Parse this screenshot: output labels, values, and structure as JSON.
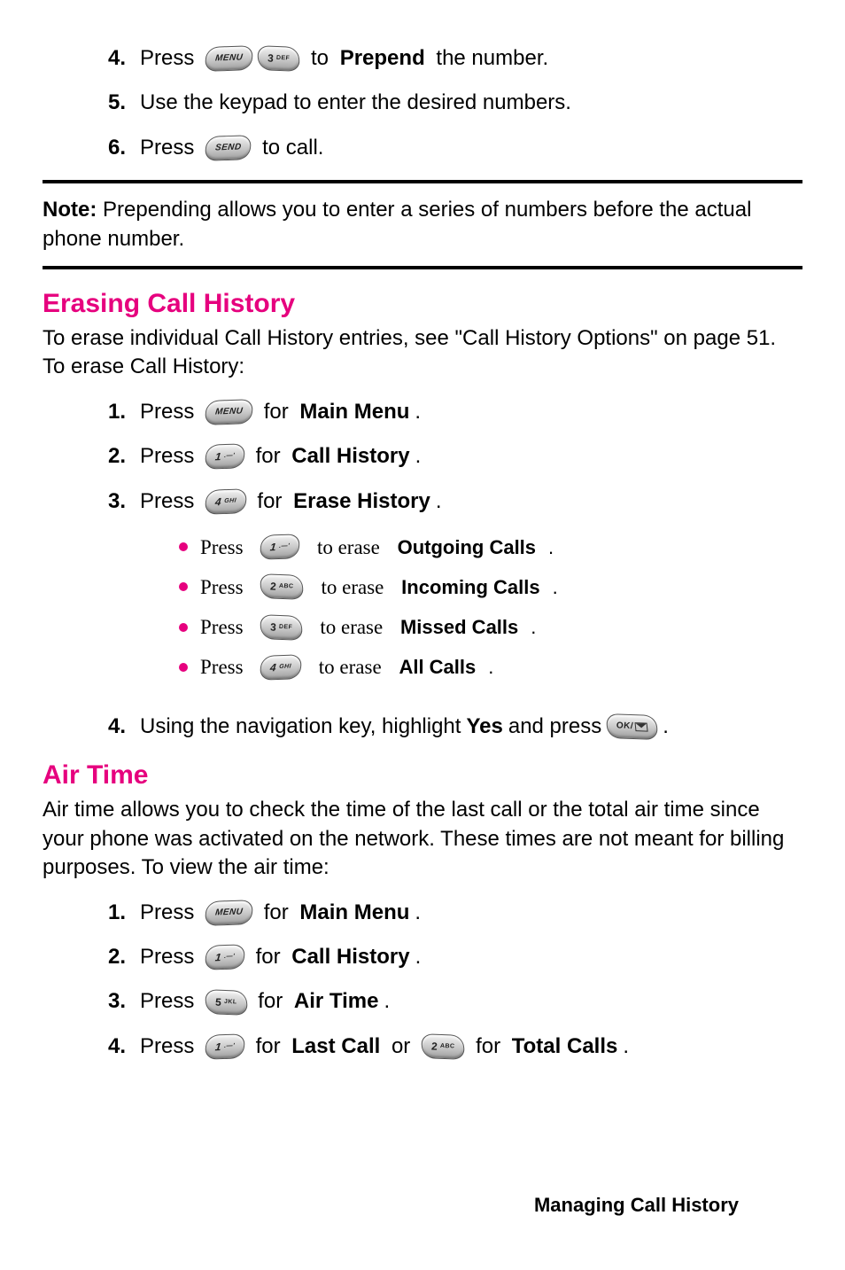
{
  "keys": {
    "menu": "MENU",
    "send": "SEND",
    "ok": "OK",
    "k1": {
      "n": "1",
      "s": ".—'"
    },
    "k2": {
      "n": "2",
      "s": "ABC"
    },
    "k3": {
      "n": "3",
      "s": "DEF"
    },
    "k4": {
      "n": "4",
      "s": "GHI"
    },
    "k5": {
      "n": "5",
      "s": "JKL"
    }
  },
  "top_steps": {
    "s4": {
      "num": "4.",
      "press": "Press ",
      "to": " to ",
      "prepend": "Prepend",
      "tail": " the number."
    },
    "s5": {
      "num": "5.",
      "text": "Use the keypad to enter the desired numbers."
    },
    "s6": {
      "num": "6.",
      "press": "Press ",
      "tail": " to call."
    }
  },
  "note": {
    "label": "Note:",
    "text": " Prepending allows you to enter a series of numbers before the actual phone number."
  },
  "erase": {
    "heading": "Erasing Call History",
    "intro": "To erase individual Call History entries, see \"Call History Options\" on page 51. To erase Call History:",
    "s1": {
      "num": "1.",
      "press": "Press ",
      "for": " for ",
      "target": "Main Menu",
      "dot": "."
    },
    "s2": {
      "num": "2.",
      "press": "Press ",
      "for": " for ",
      "target": "Call History",
      "dot": "."
    },
    "s3": {
      "num": "3.",
      "press": "Press ",
      "for": " for ",
      "target": "Erase History",
      "dot": "."
    },
    "b1": {
      "press": "Press ",
      "to": " to erase ",
      "target": "Outgoing Calls",
      "dot": "."
    },
    "b2": {
      "press": "Press ",
      "to": " to erase ",
      "target": "Incoming Calls",
      "dot": "."
    },
    "b3": {
      "press": "Press ",
      "to": " to erase ",
      "target": "Missed Calls",
      "dot": "."
    },
    "b4": {
      "press": "Press ",
      "to": " to erase ",
      "target": "All Calls",
      "dot": "."
    },
    "s4": {
      "num": "4.",
      "lead": "Using the navigation key, highlight ",
      "yes": "Yes",
      "mid": " and press ",
      "tail": " ."
    }
  },
  "air": {
    "heading": "Air Time",
    "intro": "Air time allows you to check the time of the last call or the total air time since your phone was activated on the network. These times are not meant for billing purposes. To view the air time:",
    "s1": {
      "num": "1.",
      "press": "Press ",
      "for": " for ",
      "target": "Main Menu",
      "dot": "."
    },
    "s2": {
      "num": "2.",
      "press": "Press ",
      "for": " for ",
      "target": "Call History",
      "dot": "."
    },
    "s3": {
      "num": "3.",
      "press": "Press ",
      "for": " for ",
      "target": "Air Time",
      "dot": "."
    },
    "s4": {
      "num": "4.",
      "press": "Press ",
      "for": " for ",
      "t1": "Last Call",
      "or": " or ",
      "for2": " for ",
      "t2": "Total Calls",
      "dot": "."
    }
  },
  "footer": "Managing Call History"
}
